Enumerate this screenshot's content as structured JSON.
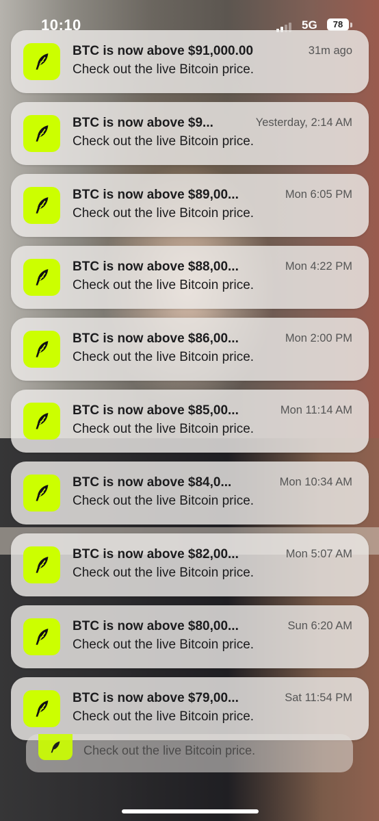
{
  "status_bar": {
    "time": "10:10",
    "network": "5G",
    "battery": "78"
  },
  "app": {
    "icon": "feather-icon",
    "icon_color": "#ccff00"
  },
  "notifications": [
    {
      "title": "BTC is now above $91,000.00",
      "time": "31m ago",
      "body": "Check out the live Bitcoin price."
    },
    {
      "title": "BTC is now above $9...",
      "time": "Yesterday, 2:14 AM",
      "body": "Check out the live Bitcoin price."
    },
    {
      "title": "BTC is now above $89,00...",
      "time": "Mon 6:05 PM",
      "body": "Check out the live Bitcoin price."
    },
    {
      "title": "BTC is now above $88,00...",
      "time": "Mon 4:22 PM",
      "body": "Check out the live Bitcoin price."
    },
    {
      "title": "BTC is now above $86,00...",
      "time": "Mon 2:00 PM",
      "body": "Check out the live Bitcoin price."
    },
    {
      "title": "BTC is now above $85,00...",
      "time": "Mon 11:14 AM",
      "body": "Check out the live Bitcoin price."
    },
    {
      "title": "BTC is now above $84,0...",
      "time": "Mon 10:34 AM",
      "body": "Check out the live Bitcoin price."
    },
    {
      "title": "BTC is now above $82,00...",
      "time": "Mon 5:07 AM",
      "body": "Check out the live Bitcoin price."
    },
    {
      "title": "BTC is now above $80,00...",
      "time": "Sun 6:20 AM",
      "body": "Check out the live Bitcoin price."
    },
    {
      "title": "BTC is now above $79,00...",
      "time": "Sat 11:54 PM",
      "body": "Check out the live Bitcoin price."
    }
  ],
  "stack_peek": {
    "body": "Check out the live Bitcoin price."
  }
}
